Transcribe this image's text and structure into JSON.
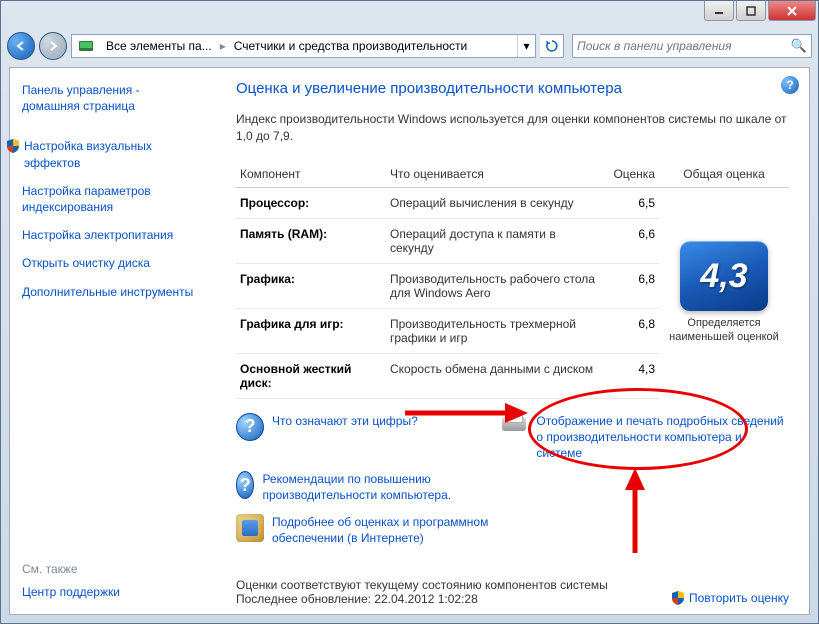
{
  "breadcrumbs": {
    "item1": "Все элементы па...",
    "item2": "Счетчики и средства производительности"
  },
  "search": {
    "placeholder": "Поиск в панели управления"
  },
  "sidebar": {
    "home": "Панель управления - домашняя страница",
    "items": [
      "Настройка визуальных эффектов",
      "Настройка параметров индексирования",
      "Настройка электропитания",
      "Открыть очистку диска",
      "Дополнительные инструменты"
    ],
    "see_also_hdr": "См. также",
    "see_also": "Центр поддержки"
  },
  "main": {
    "title": "Оценка и увеличение производительности компьютера",
    "desc": "Индекс производительности Windows используется для оценки компонентов системы по шкале от 1,0 до 7,9.",
    "headers": {
      "component": "Компонент",
      "what": "Что оценивается",
      "score": "Оценка",
      "overall": "Общая оценка"
    },
    "rows": [
      {
        "name": "Процессор:",
        "what": "Операций вычисления в секунду",
        "score": "6,5"
      },
      {
        "name": "Память (RAM):",
        "what": "Операций доступа к памяти в секунду",
        "score": "6,6"
      },
      {
        "name": "Графика:",
        "what": "Производительность рабочего стола для Windows Aero",
        "score": "6,8"
      },
      {
        "name": "Графика для игр:",
        "what": "Производительность трехмерной графики и игр",
        "score": "6,8"
      },
      {
        "name": "Основной жесткий диск:",
        "what": "Скорость обмена данными с диском",
        "score": "4,3"
      }
    ],
    "big_score": "4,3",
    "big_score_label": "Определяется наименьшей оценкой",
    "links": {
      "what_numbers": "Что означают эти цифры?",
      "recommendations": "Рекомендации по повышению производительности компьютера.",
      "print_details": "Отображение и печать подробных сведений о производительности компьютера и системе",
      "online": "Подробнее об оценках и программном обеспечении (в Интернете)"
    },
    "footer": {
      "line1": "Оценки соответствуют текущему состоянию компонентов системы",
      "line2": "Последнее обновление: 22.04.2012 1:02:28",
      "rescore": "Повторить оценку"
    }
  }
}
